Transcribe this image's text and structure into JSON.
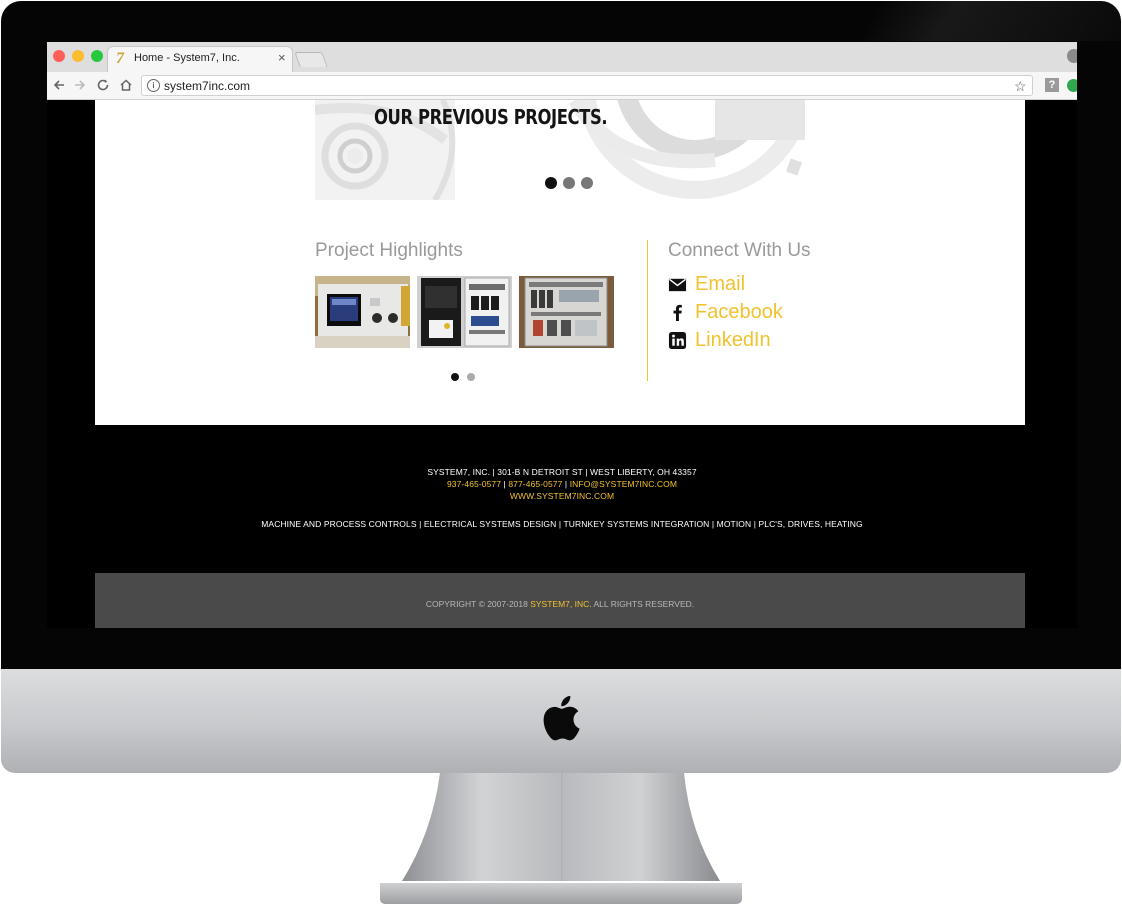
{
  "browser": {
    "tab_title": "Home - System7, Inc.",
    "tab_favicon": "7",
    "tab_close": "×",
    "url": "system7inc.com",
    "icons": [
      "back-arrow-icon",
      "forward-arrow-icon",
      "reload-icon",
      "home-icon",
      "info-icon",
      "star-icon",
      "profile-icon"
    ]
  },
  "slider": {
    "title": "OUR PREVIOUS PROJECTS.",
    "dots": 3,
    "active_dot": 0
  },
  "highlights": {
    "title": "Project Highlights",
    "thumbnails": [
      "control-panel-photo",
      "electrical-cabinet-photo",
      "wiring-cabinet-photo"
    ],
    "dots": 2,
    "active_dot": 0
  },
  "connect": {
    "title": "Connect With Us",
    "items": [
      {
        "label": "Email",
        "icon": "envelope-icon"
      },
      {
        "label": "Facebook",
        "icon": "facebook-icon"
      },
      {
        "label": "LinkedIn",
        "icon": "linkedin-icon"
      }
    ]
  },
  "footer": {
    "address": "SYSTEM7, INC. | 301-B N DETROIT ST | WEST LIBERTY, OH 43357",
    "phone1": "937-465-0577",
    "sep": " | ",
    "phone2": "877-465-0577",
    "email": "INFO@SYSTEM7INC.COM",
    "website": "WWW.SYSTEM7INC.COM",
    "services": "MACHINE AND PROCESS CONTROLS | ELECTRICAL SYSTEMS DESIGN | TURNKEY SYSTEMS INTEGRATION | MOTION | PLC'S, DRIVES, HEATING",
    "copyright_prefix": "COPYRIGHT © 2007-2018 ",
    "copyright_brand": "SYSTEM7, INC.",
    "copyright_suffix": " ALL RIGHTS RESERVED."
  },
  "colors": {
    "accent": "#f0c22e",
    "footer_bg": "#000000",
    "copyright_bg": "#4a4a4a"
  }
}
